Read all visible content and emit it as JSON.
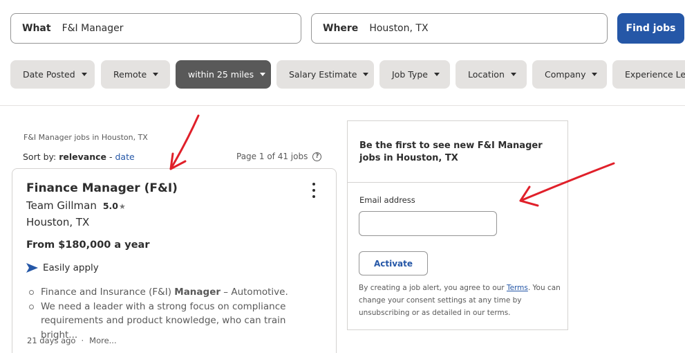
{
  "search": {
    "what_label": "What",
    "what_value": "F&I Manager",
    "where_label": "Where",
    "where_value": "Houston, TX",
    "find_button": "Find jobs"
  },
  "filters": [
    {
      "label": "Date Posted",
      "active": false
    },
    {
      "label": "Remote",
      "active": false
    },
    {
      "label": "within 25 miles",
      "active": true
    },
    {
      "label": "Salary Estimate",
      "active": false
    },
    {
      "label": "Job Type",
      "active": false
    },
    {
      "label": "Location",
      "active": false
    },
    {
      "label": "Company",
      "active": false
    },
    {
      "label": "Experience Level",
      "active": false
    }
  ],
  "results": {
    "header": "F&I Manager jobs in Houston, TX",
    "sort_prefix": "Sort by:",
    "sort_active": "relevance",
    "sort_separator": " - ",
    "sort_other": "date",
    "page_count": "Page 1 of 41 jobs"
  },
  "job": {
    "title": "Finance Manager (F&I)",
    "company": "Team Gillman",
    "rating": "5.0",
    "star_glyph": "★",
    "location": "Houston, TX",
    "salary": "From $180,000 a year",
    "easy_apply": "Easily apply",
    "snippet_1_pre": "Finance and Insurance (F&I) ",
    "snippet_1_bold": "Manager",
    "snippet_1_post": " – Automotive.",
    "snippet_2": "We need a leader with a strong focus on compliance requirements and product knowledge, who can train bright...",
    "posted": "21 days ago",
    "meta_dot": "·",
    "more": "More..."
  },
  "alert": {
    "title": "Be the first to see new F&I Manager jobs in Houston, TX",
    "email_label": "Email address",
    "email_value": "",
    "activate": "Activate",
    "terms_pre": "By creating a job alert, you agree to our ",
    "terms_link": "Terms",
    "terms_post": ". You can change your consent settings at any time by unsubscribing or as detailed in our terms."
  },
  "colors": {
    "brand_blue": "#2557a7",
    "active_filter": "#595959",
    "annotation_red": "#e0202a"
  },
  "icons": [
    "caret-down-icon",
    "help-icon",
    "more-options-icon",
    "star-icon",
    "easy-apply-icon",
    "annotation-arrow"
  ]
}
